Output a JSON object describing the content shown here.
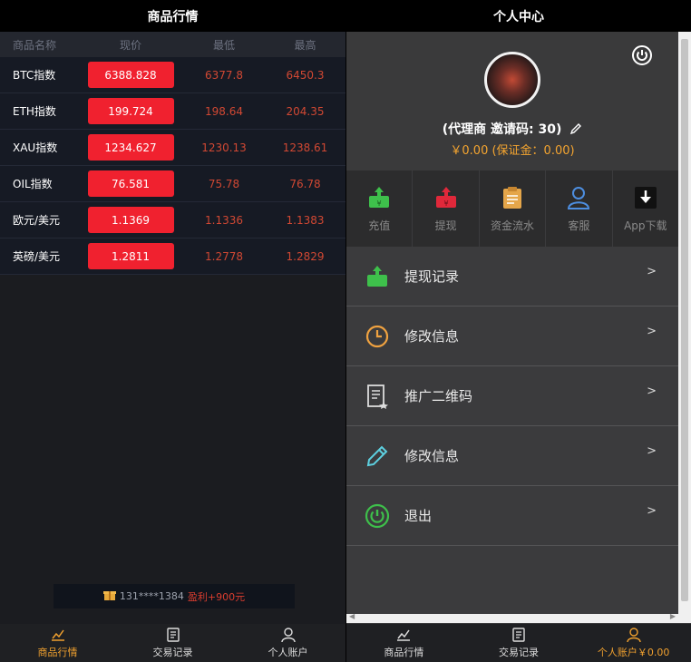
{
  "left": {
    "title": "商品行情",
    "headers": [
      "商品名称",
      "现价",
      "最低",
      "最高"
    ],
    "rows": [
      {
        "name": "BTC指数",
        "price": "6388.828",
        "low": "6377.8",
        "high": "6450.3"
      },
      {
        "name": "ETH指数",
        "price": "199.724",
        "low": "198.64",
        "high": "204.35"
      },
      {
        "name": "XAU指数",
        "price": "1234.627",
        "low": "1230.13",
        "high": "1238.61"
      },
      {
        "name": "OIL指数",
        "price": "76.581",
        "low": "75.78",
        "high": "76.78"
      },
      {
        "name": "欧元/美元",
        "price": "1.1369",
        "low": "1.1336",
        "high": "1.1383"
      },
      {
        "name": "英磅/美元",
        "price": "1.2811",
        "low": "1.2778",
        "high": "1.2829"
      }
    ],
    "ticker": {
      "user": "131****1384",
      "gain": "盈利+900元"
    },
    "nav": [
      "商品行情",
      "交易记录",
      "个人账户"
    ]
  },
  "right": {
    "title": "个人中心",
    "profile": {
      "name": "(代理商 邀请码: 30)",
      "balance": "￥0.00 (保证金：0.00)"
    },
    "quick": [
      "充值",
      "提现",
      "资金流水",
      "客服",
      "App下载"
    ],
    "menu": [
      "提现记录",
      "修改信息",
      "推广二维码",
      "修改信息",
      "退出"
    ],
    "arrow": ">",
    "nav": [
      "商品行情",
      "交易记录",
      "个人账户￥0.00"
    ]
  },
  "colors": {
    "accent": "#f1a12f",
    "price_bg": "#f0212f",
    "low_high": "#d14833"
  }
}
